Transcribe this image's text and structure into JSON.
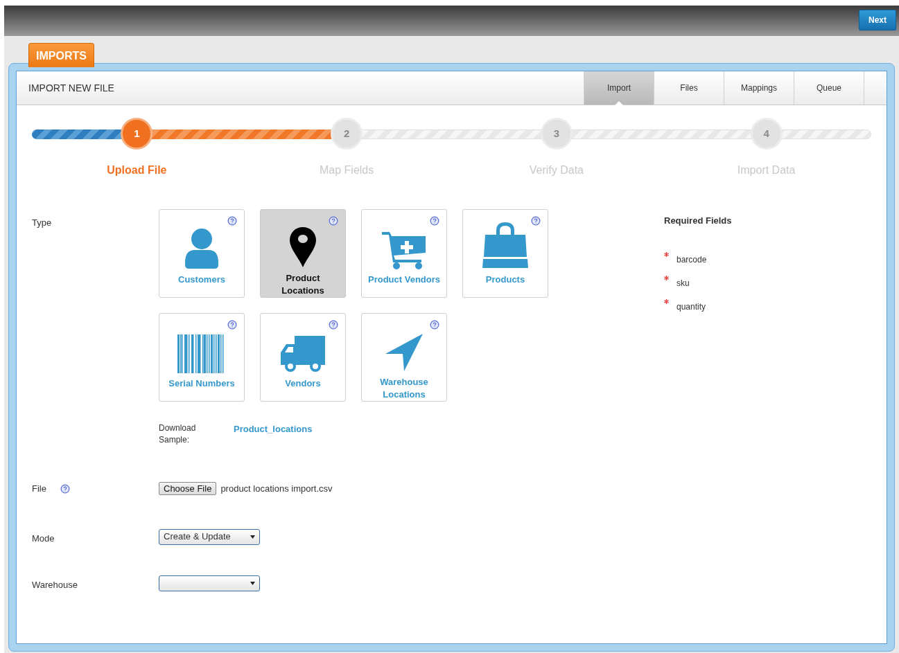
{
  "top_bar": {
    "next_button": "Next"
  },
  "section_tab": "IMPORTS",
  "panel": {
    "title": "IMPORT NEW FILE",
    "tabs": [
      {
        "label": "Import",
        "selected": true
      },
      {
        "label": "Files",
        "selected": false
      },
      {
        "label": "Mappings",
        "selected": false
      },
      {
        "label": "Queue",
        "selected": false
      }
    ]
  },
  "steps": [
    {
      "number": "1",
      "label": "Upload File",
      "selected": true
    },
    {
      "number": "2",
      "label": "Map Fields",
      "selected": false
    },
    {
      "number": "3",
      "label": "Verify Data",
      "selected": false
    },
    {
      "number": "4",
      "label": "Import Data",
      "selected": false
    }
  ],
  "type": {
    "label": "Type",
    "tiles": [
      {
        "label": "Customers",
        "kind": "person",
        "selected": false
      },
      {
        "label": "Product Locations",
        "kind": "pin",
        "selected": true
      },
      {
        "label": "Product Vendors",
        "kind": "cart",
        "selected": false
      },
      {
        "label": "Products",
        "kind": "bag",
        "selected": false
      },
      {
        "label": "Serial Numbers",
        "kind": "barcode",
        "selected": false
      },
      {
        "label": "Vendors",
        "kind": "truck",
        "selected": false
      },
      {
        "label": "Warehouse Locations",
        "kind": "arrow",
        "selected": false
      }
    ]
  },
  "download_sample": {
    "label": "Download Sample:",
    "link": "Product_locations"
  },
  "file": {
    "label": "File",
    "button": "Choose File",
    "value": "product locations import.csv"
  },
  "mode": {
    "label": "Mode",
    "value": "Create & Update"
  },
  "warehouse": {
    "label": "Warehouse"
  },
  "required_fields": {
    "title": "Required Fields",
    "items": [
      "barcode",
      "sku",
      "quantity"
    ]
  }
}
